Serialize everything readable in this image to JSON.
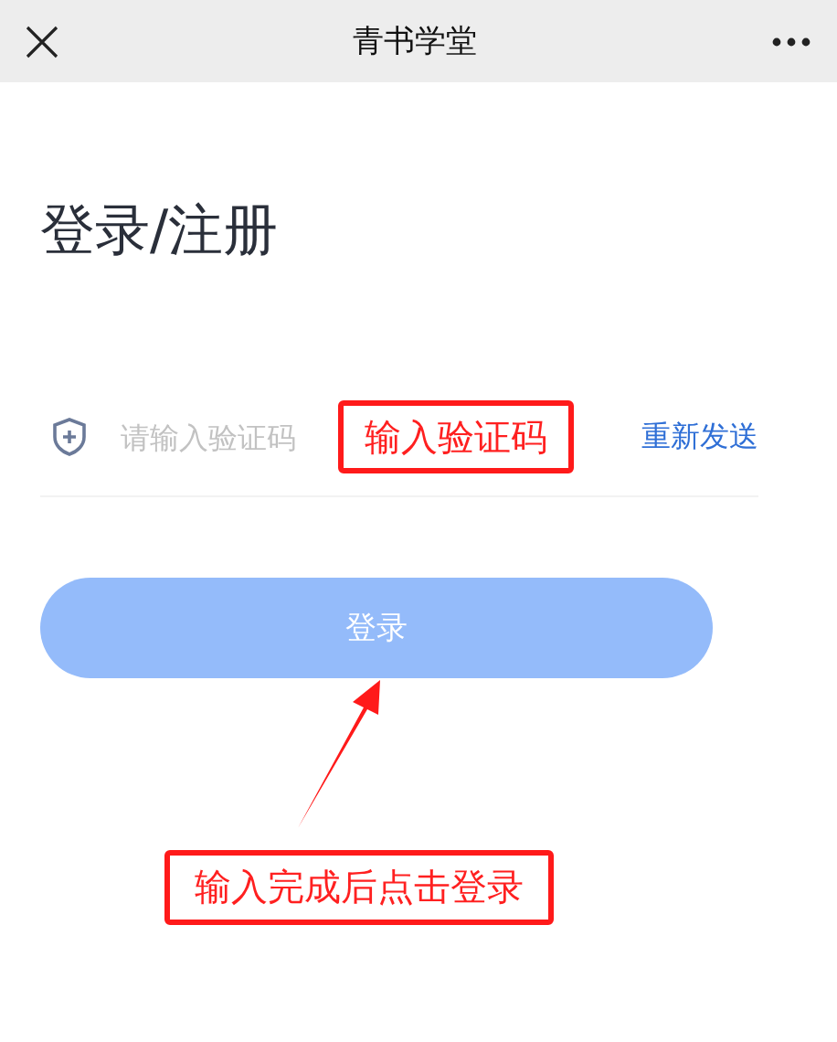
{
  "header": {
    "title": "青书学堂"
  },
  "page_title": "登录/注册",
  "code_field": {
    "placeholder": "请输入验证码"
  },
  "resend_link": "重新发送",
  "login_button": {
    "label": "登录",
    "disabled": true
  },
  "annotations": [
    {
      "kind": "field-note",
      "text": "输入验证码"
    },
    {
      "kind": "button-note",
      "text": "输入完成后点击登录"
    }
  ]
}
